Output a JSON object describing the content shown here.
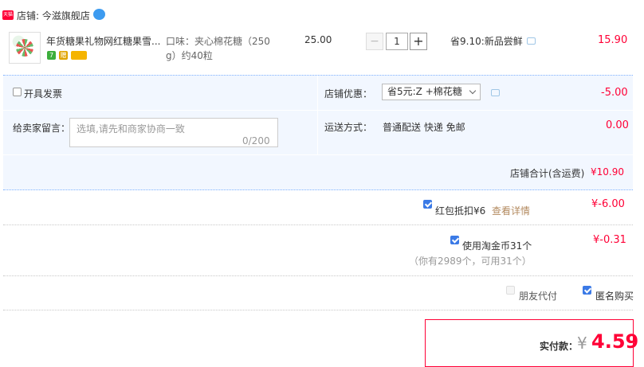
{
  "store": {
    "label": "店铺: 今滋旗舰店"
  },
  "item": {
    "title": "年货糖果礼物网红糖果雪...",
    "sku_line1": "口味：夹心棉花糖（250",
    "sku_line2": "g）约40粒",
    "unit_price": "25.00",
    "quantity": "1",
    "qty_minus": "−",
    "qty_plus": "+",
    "promo": "省9.10:新品尝鲜",
    "subtotal": "15.90",
    "badges": [
      "7",
      "赠"
    ]
  },
  "invoice": {
    "label": "开具发票",
    "checked": false
  },
  "discount": {
    "label": "店铺优惠：",
    "selected": "省5元:Z +棉花糖",
    "amount": "-5.00"
  },
  "message": {
    "label": "给卖家留言：",
    "placeholder": "选填,请先和商家协商一致",
    "counter": "0/200"
  },
  "shipping": {
    "label": "运送方式：",
    "value": "普通配送 快递 免邮",
    "amount": "0.00"
  },
  "store_total": {
    "label": "店铺合计(含运费)",
    "value": "¥10.90"
  },
  "red_packet": {
    "label": "红包抵扣¥6",
    "link": "查看详情",
    "amount": "¥-6.00",
    "checked": true
  },
  "taojinbi": {
    "label": "使用淘金币31个",
    "note": "（你有2989个，可用31个）",
    "amount": "¥-0.31",
    "checked": true
  },
  "options": {
    "friend_pay": "朋友代付",
    "anonymous": "匿名购买"
  },
  "payment": {
    "label": "实付款：",
    "currency": "¥",
    "amount": "4.59"
  },
  "colors": {
    "accent_red": "#ff0036",
    "panel_blue": "#f2f7ff",
    "checkbox_blue": "#3b7ae6"
  }
}
